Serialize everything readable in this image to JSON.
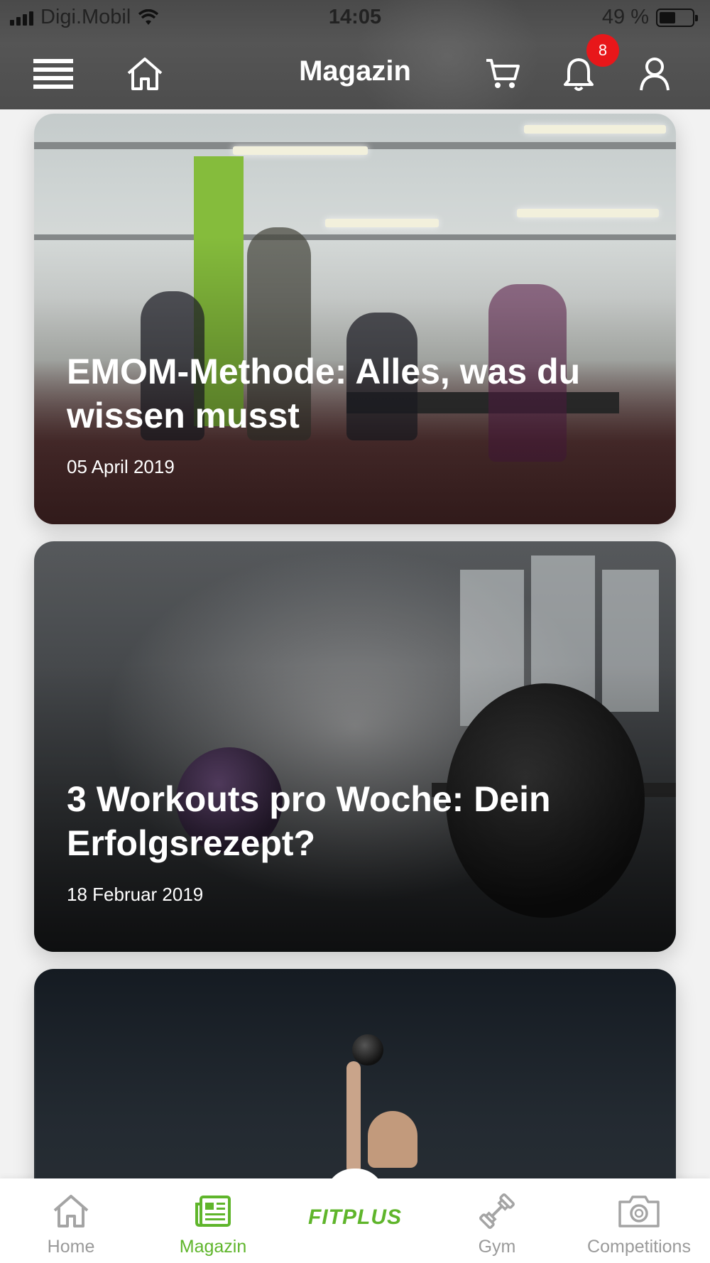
{
  "status_bar": {
    "carrier": "Digi.Mobil",
    "time": "14:05",
    "battery_percent": "49 %",
    "battery_level": 0.49
  },
  "nav": {
    "title": "Magazin",
    "icons": [
      "menu-icon",
      "home-icon",
      "cart-icon",
      "bell-icon",
      "user-icon"
    ],
    "notification_count": "8"
  },
  "articles": [
    {
      "title": "EMOM-Methode: Alles, was du wissen musst",
      "date": "05 April 2019"
    },
    {
      "title": "3 Workouts pro Woche: Dein Erfolgsrezept?",
      "date": "18 Februar 2019"
    },
    {
      "title": "",
      "date": ""
    }
  ],
  "tabbar": {
    "logo": "FITPLUS",
    "tabs": [
      {
        "label": "Home",
        "icon": "home-icon",
        "active": false
      },
      {
        "label": "Magazin",
        "icon": "newspaper-icon",
        "active": true
      },
      {
        "label": "Gym",
        "icon": "dumbbell-icon",
        "active": false
      },
      {
        "label": "Competitions",
        "icon": "camera-icon",
        "active": false
      }
    ]
  },
  "colors": {
    "accent": "#5fb52b",
    "badge": "#e8171a",
    "header": "#4d4d4d"
  }
}
